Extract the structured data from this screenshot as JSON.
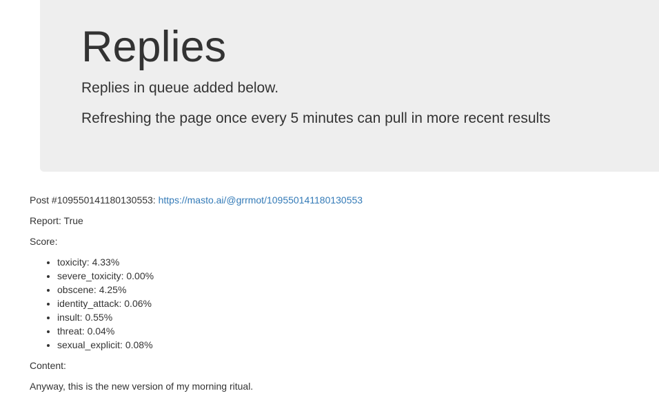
{
  "header": {
    "title": "Replies",
    "subtitle": "Replies in queue added below.",
    "note": "Refreshing the page once every 5 minutes can pull in more recent results"
  },
  "post": {
    "label": "Post #109550141180130553:",
    "link_text": "https://masto.ai/@grrmot/109550141180130553",
    "report": "Report: True",
    "score_label": "Score:",
    "scores": [
      "toxicity: 4.33%",
      "severe_toxicity: 0.00%",
      "obscene: 4.25%",
      "identity_attack: 0.06%",
      "insult: 0.55%",
      "threat: 0.04%",
      "sexual_explicit: 0.08%"
    ],
    "content_label": "Content:",
    "content_text": "Anyway, this is the new version of my morning ritual."
  },
  "colors": {
    "jumbotron_bg": "#eeeeee",
    "link": "#337ab7",
    "text": "#333333"
  }
}
